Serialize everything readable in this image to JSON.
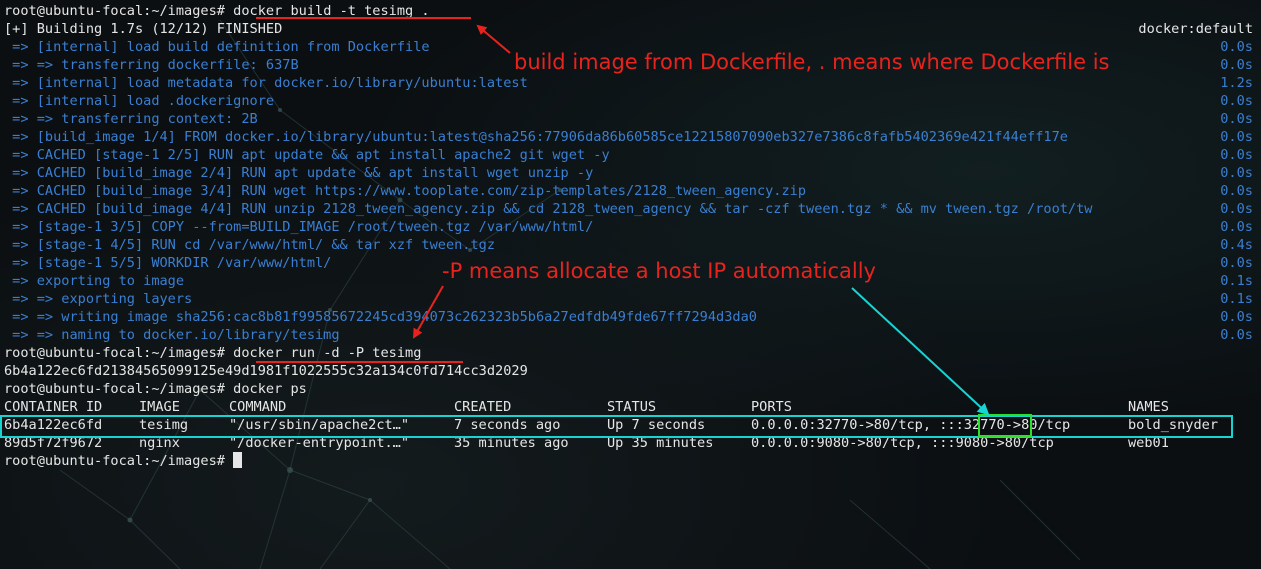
{
  "prompt": "root@ubuntu-focal:~/images#",
  "commands": {
    "build": "docker build -t tesimg .",
    "run": "docker run -d -P tesimg",
    "ps": "docker ps"
  },
  "build_output": {
    "status_line": "[+] Building 1.7s (12/12) FINISHED",
    "builder": "docker:default",
    "steps": [
      {
        "text": " => [internal] load build definition from Dockerfile",
        "time": "0.0s"
      },
      {
        "text": " => => transferring dockerfile: 637B",
        "time": "0.0s"
      },
      {
        "text": " => [internal] load metadata for docker.io/library/ubuntu:latest",
        "time": "1.2s"
      },
      {
        "text": " => [internal] load .dockerignore",
        "time": "0.0s"
      },
      {
        "text": " => => transferring context: 2B",
        "time": "0.0s"
      },
      {
        "text": " => [build_image 1/4] FROM docker.io/library/ubuntu:latest@sha256:77906da86b60585ce12215807090eb327e7386c8fafb5402369e421f44eff17e",
        "time": "0.0s"
      },
      {
        "text": " => CACHED [stage-1 2/5] RUN apt update && apt install apache2 git wget -y",
        "time": "0.0s"
      },
      {
        "text": " => CACHED [build_image 2/4] RUN apt update && apt install wget unzip -y",
        "time": "0.0s"
      },
      {
        "text": " => CACHED [build_image 3/4] RUN wget https://www.tooplate.com/zip-templates/2128_tween_agency.zip",
        "time": "0.0s"
      },
      {
        "text": " => CACHED [build_image 4/4] RUN unzip 2128_tween_agency.zip && cd 2128_tween_agency && tar -czf tween.tgz * && mv tween.tgz /root/tw",
        "time": "0.0s"
      },
      {
        "text": " => [stage-1 3/5] COPY --from=BUILD_IMAGE /root/tween.tgz /var/www/html/",
        "time": "0.0s"
      },
      {
        "text": " => [stage-1 4/5] RUN cd /var/www/html/ && tar xzf tween.tgz",
        "time": "0.4s"
      },
      {
        "text": " => [stage-1 5/5] WORKDIR /var/www/html/",
        "time": "0.0s"
      },
      {
        "text": " => exporting to image",
        "time": "0.1s"
      },
      {
        "text": " => => exporting layers",
        "time": "0.1s"
      },
      {
        "text": " => => writing image sha256:cac8b81f99585672245cd394073c262323b5b6a27edfdb49fde67ff7294d3da0",
        "time": "0.0s"
      },
      {
        "text": " => => naming to docker.io/library/tesimg",
        "time": "0.0s"
      }
    ]
  },
  "run_output": "6b4a122ec6fd21384565099125e49d1981f1022555c32a134c0fd714cc3d2029",
  "ps_table": {
    "headers": [
      "CONTAINER ID",
      "IMAGE",
      "COMMAND",
      "CREATED",
      "STATUS",
      "PORTS",
      "NAMES"
    ],
    "rows": [
      [
        "6b4a122ec6fd",
        "tesimg",
        "\"/usr/sbin/apache2ct…\"",
        "7 seconds ago",
        "Up 7 seconds",
        "0.0.0.0:32770->80/tcp, :::32770->80/tcp",
        "bold_snyder"
      ],
      [
        "89d5f72f9672",
        "nginx",
        "\"/docker-entrypoint.…\"",
        "35 minutes ago",
        "Up 35 minutes",
        "0.0.0.0:9080->80/tcp, :::9080->80/tcp",
        "web01"
      ]
    ]
  },
  "annotations": {
    "build_note": "build image from Dockerfile, . means where Dockerfile is",
    "run_note": "-P means allocate a host IP automatically"
  },
  "colors": {
    "annotation": "#e8231d",
    "row_highlight": "#19d3d3",
    "port_highlight": "#2ee02e",
    "build_text": "#3a7fd1",
    "text": "#e6e6e6",
    "background": "#0b0f12"
  }
}
